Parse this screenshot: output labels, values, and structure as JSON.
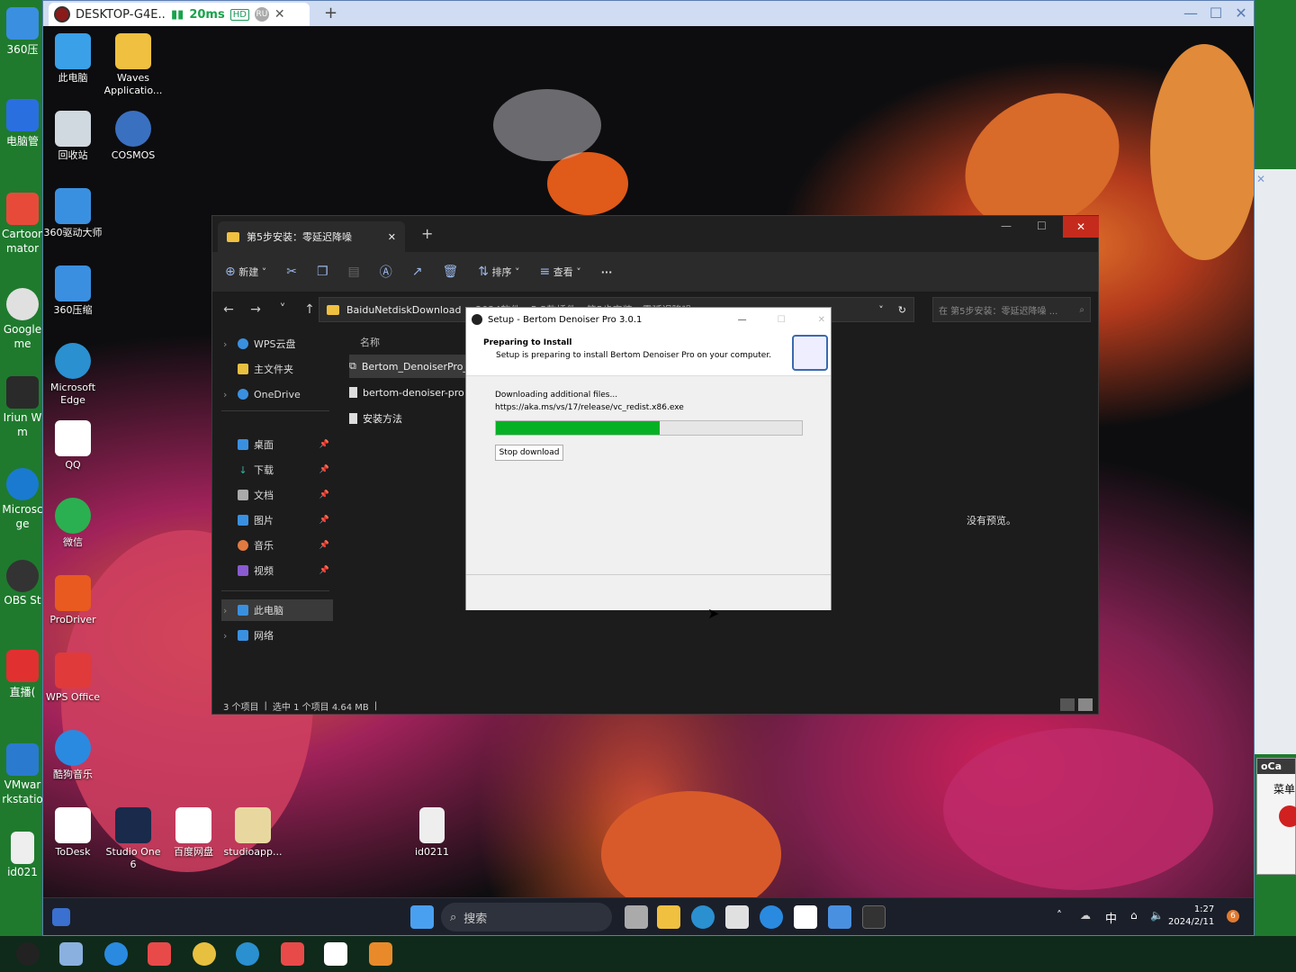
{
  "remote_window": {
    "tab_title": "DESKTOP-G4E...",
    "latency": "20ms",
    "hd_badge": "HD",
    "ru_badge": "RU",
    "new_tab": "+",
    "minimize": "—",
    "maximize": "☐",
    "close": "✕"
  },
  "local_desktop": {
    "left_icons": [
      {
        "label": "360压",
        "color": "#3a8fe0"
      },
      {
        "label": "电脑管",
        "color": "#2a6fe0"
      },
      {
        "label": "Cartoon\nmator",
        "color": "#e84a3a"
      },
      {
        "label": "Google\nme",
        "color": "#e0e0e0"
      },
      {
        "label": "Microsoft\nEdge",
        "color": "#2a90d0"
      },
      {
        "label": "Iriun W\nm",
        "color": "#2a2a2a"
      },
      {
        "label": "Microsc\nge",
        "color": "#1a7ad0"
      },
      {
        "label": "OBS St",
        "color": "#333"
      },
      {
        "label": "直播(",
        "color": "#e03030"
      },
      {
        "label": "VMwar\nrkstatio",
        "color": "#2a7ad0"
      },
      {
        "label": "id021",
        "color": "#eee"
      }
    ]
  },
  "desktop_icons": [
    {
      "label": "此电脑",
      "color": "#3aa0e8"
    },
    {
      "label": "Waves\nApplicatio...",
      "color": "#f0c040"
    },
    {
      "label": "回收站",
      "color": "#d0d8e0"
    },
    {
      "label": "COSMOS",
      "color": "#3a70c0"
    },
    {
      "label": "360驱动大师",
      "color": "#3a90e0"
    },
    {
      "label": "360压缩",
      "color": "#3a8fe0"
    },
    {
      "label": "Microsoft\nEdge",
      "color": "#2a90d0"
    },
    {
      "label": "QQ",
      "color": "#fff"
    },
    {
      "label": "微信",
      "color": "#2ab050"
    },
    {
      "label": "ProDriver",
      "color": "#e85a20"
    },
    {
      "label": "WPS Office",
      "color": "#e03a3a"
    },
    {
      "label": "酷狗音乐",
      "color": "#2a8ae0"
    },
    {
      "label": "ToDesk",
      "color": "#fff"
    },
    {
      "label": "Studio One\n6",
      "color": "#1a2a4a"
    },
    {
      "label": "百度网盘",
      "color": "#fff"
    },
    {
      "label": "studioapp...",
      "color": "#e8d8a0"
    },
    {
      "label": "id0211",
      "color": "#eee"
    }
  ],
  "explorer": {
    "tab_title": "第5步安装：零延迟降噪",
    "new_tab": "+",
    "toolbar": {
      "new": "新建",
      "sort": "排序",
      "view": "查看",
      "more": "···"
    },
    "address": "BaiduNetdiskDownload",
    "address_more": "› 2024软件 › 5.5款插件 › 第5步安装：零延迟降噪",
    "search_placeholder": "在 第5步安装：零延迟降噪 ...",
    "nav": [
      {
        "label": "WPS云盘",
        "color": "#3a90e0"
      },
      {
        "label": "主文件夹",
        "color": "#e8c040"
      },
      {
        "label": "OneDrive",
        "color": "#3a90e0"
      },
      {
        "label": "桌面",
        "color": "#3a90e0"
      },
      {
        "label": "下载",
        "color": "#3ab0a0"
      },
      {
        "label": "文档",
        "color": "#aaa"
      },
      {
        "label": "图片",
        "color": "#3a90e0"
      },
      {
        "label": "音乐",
        "color": "#e07a40"
      },
      {
        "label": "视频",
        "color": "#8a5ad0"
      },
      {
        "label": "此电脑",
        "color": "#3a90e0"
      },
      {
        "label": "网络",
        "color": "#3a90e0"
      }
    ],
    "column_header": "名称",
    "files": [
      {
        "name": "Bertom_DenoiserPro_"
      },
      {
        "name": "bertom-denoiser-pro"
      },
      {
        "name": "安装方法"
      }
    ],
    "preview_text": "没有预览。",
    "status": {
      "count": "3 个项目",
      "selected": "选中 1 个项目  4.64 MB"
    }
  },
  "setup": {
    "title": "Setup - Bertom Denoiser Pro 3.0.1",
    "heading": "Preparing to Install",
    "subheading": "Setup is preparing to install Bertom Denoiser Pro on your computer.",
    "downloading": "Downloading additional files...",
    "url": "https://aka.ms/vs/17/release/vc_redist.x86.exe",
    "progress": 0.535,
    "stop_button": "Stop download"
  },
  "remote_taskbar": {
    "search_label": "搜索",
    "ime": "中",
    "time": "1:27",
    "date": "2024/2/11",
    "notification_count": "6"
  },
  "right_strip": {
    "app_label": "oCa",
    "menu_label": "菜单"
  }
}
